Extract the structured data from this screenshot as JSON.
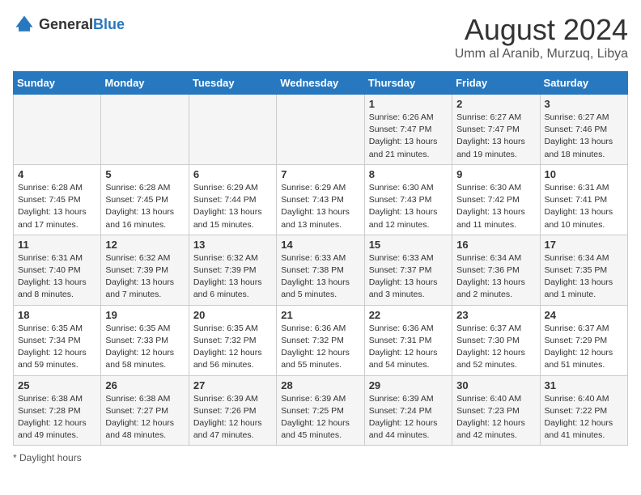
{
  "header": {
    "logo_general": "General",
    "logo_blue": "Blue",
    "title": "August 2024",
    "subtitle": "Umm al Aranib, Murzuq, Libya"
  },
  "days_of_week": [
    "Sunday",
    "Monday",
    "Tuesday",
    "Wednesday",
    "Thursday",
    "Friday",
    "Saturday"
  ],
  "weeks": [
    [
      {
        "day": "",
        "info": ""
      },
      {
        "day": "",
        "info": ""
      },
      {
        "day": "",
        "info": ""
      },
      {
        "day": "",
        "info": ""
      },
      {
        "day": "1",
        "info": "Sunrise: 6:26 AM\nSunset: 7:47 PM\nDaylight: 13 hours\nand 21 minutes."
      },
      {
        "day": "2",
        "info": "Sunrise: 6:27 AM\nSunset: 7:47 PM\nDaylight: 13 hours\nand 19 minutes."
      },
      {
        "day": "3",
        "info": "Sunrise: 6:27 AM\nSunset: 7:46 PM\nDaylight: 13 hours\nand 18 minutes."
      }
    ],
    [
      {
        "day": "4",
        "info": "Sunrise: 6:28 AM\nSunset: 7:45 PM\nDaylight: 13 hours\nand 17 minutes."
      },
      {
        "day": "5",
        "info": "Sunrise: 6:28 AM\nSunset: 7:45 PM\nDaylight: 13 hours\nand 16 minutes."
      },
      {
        "day": "6",
        "info": "Sunrise: 6:29 AM\nSunset: 7:44 PM\nDaylight: 13 hours\nand 15 minutes."
      },
      {
        "day": "7",
        "info": "Sunrise: 6:29 AM\nSunset: 7:43 PM\nDaylight: 13 hours\nand 13 minutes."
      },
      {
        "day": "8",
        "info": "Sunrise: 6:30 AM\nSunset: 7:43 PM\nDaylight: 13 hours\nand 12 minutes."
      },
      {
        "day": "9",
        "info": "Sunrise: 6:30 AM\nSunset: 7:42 PM\nDaylight: 13 hours\nand 11 minutes."
      },
      {
        "day": "10",
        "info": "Sunrise: 6:31 AM\nSunset: 7:41 PM\nDaylight: 13 hours\nand 10 minutes."
      }
    ],
    [
      {
        "day": "11",
        "info": "Sunrise: 6:31 AM\nSunset: 7:40 PM\nDaylight: 13 hours\nand 8 minutes."
      },
      {
        "day": "12",
        "info": "Sunrise: 6:32 AM\nSunset: 7:39 PM\nDaylight: 13 hours\nand 7 minutes."
      },
      {
        "day": "13",
        "info": "Sunrise: 6:32 AM\nSunset: 7:39 PM\nDaylight: 13 hours\nand 6 minutes."
      },
      {
        "day": "14",
        "info": "Sunrise: 6:33 AM\nSunset: 7:38 PM\nDaylight: 13 hours\nand 5 minutes."
      },
      {
        "day": "15",
        "info": "Sunrise: 6:33 AM\nSunset: 7:37 PM\nDaylight: 13 hours\nand 3 minutes."
      },
      {
        "day": "16",
        "info": "Sunrise: 6:34 AM\nSunset: 7:36 PM\nDaylight: 13 hours\nand 2 minutes."
      },
      {
        "day": "17",
        "info": "Sunrise: 6:34 AM\nSunset: 7:35 PM\nDaylight: 13 hours\nand 1 minute."
      }
    ],
    [
      {
        "day": "18",
        "info": "Sunrise: 6:35 AM\nSunset: 7:34 PM\nDaylight: 12 hours\nand 59 minutes."
      },
      {
        "day": "19",
        "info": "Sunrise: 6:35 AM\nSunset: 7:33 PM\nDaylight: 12 hours\nand 58 minutes."
      },
      {
        "day": "20",
        "info": "Sunrise: 6:35 AM\nSunset: 7:32 PM\nDaylight: 12 hours\nand 56 minutes."
      },
      {
        "day": "21",
        "info": "Sunrise: 6:36 AM\nSunset: 7:32 PM\nDaylight: 12 hours\nand 55 minutes."
      },
      {
        "day": "22",
        "info": "Sunrise: 6:36 AM\nSunset: 7:31 PM\nDaylight: 12 hours\nand 54 minutes."
      },
      {
        "day": "23",
        "info": "Sunrise: 6:37 AM\nSunset: 7:30 PM\nDaylight: 12 hours\nand 52 minutes."
      },
      {
        "day": "24",
        "info": "Sunrise: 6:37 AM\nSunset: 7:29 PM\nDaylight: 12 hours\nand 51 minutes."
      }
    ],
    [
      {
        "day": "25",
        "info": "Sunrise: 6:38 AM\nSunset: 7:28 PM\nDaylight: 12 hours\nand 49 minutes."
      },
      {
        "day": "26",
        "info": "Sunrise: 6:38 AM\nSunset: 7:27 PM\nDaylight: 12 hours\nand 48 minutes."
      },
      {
        "day": "27",
        "info": "Sunrise: 6:39 AM\nSunset: 7:26 PM\nDaylight: 12 hours\nand 47 minutes."
      },
      {
        "day": "28",
        "info": "Sunrise: 6:39 AM\nSunset: 7:25 PM\nDaylight: 12 hours\nand 45 minutes."
      },
      {
        "day": "29",
        "info": "Sunrise: 6:39 AM\nSunset: 7:24 PM\nDaylight: 12 hours\nand 44 minutes."
      },
      {
        "day": "30",
        "info": "Sunrise: 6:40 AM\nSunset: 7:23 PM\nDaylight: 12 hours\nand 42 minutes."
      },
      {
        "day": "31",
        "info": "Sunrise: 6:40 AM\nSunset: 7:22 PM\nDaylight: 12 hours\nand 41 minutes."
      }
    ]
  ],
  "footer": {
    "daylight_hours_label": "Daylight hours"
  }
}
